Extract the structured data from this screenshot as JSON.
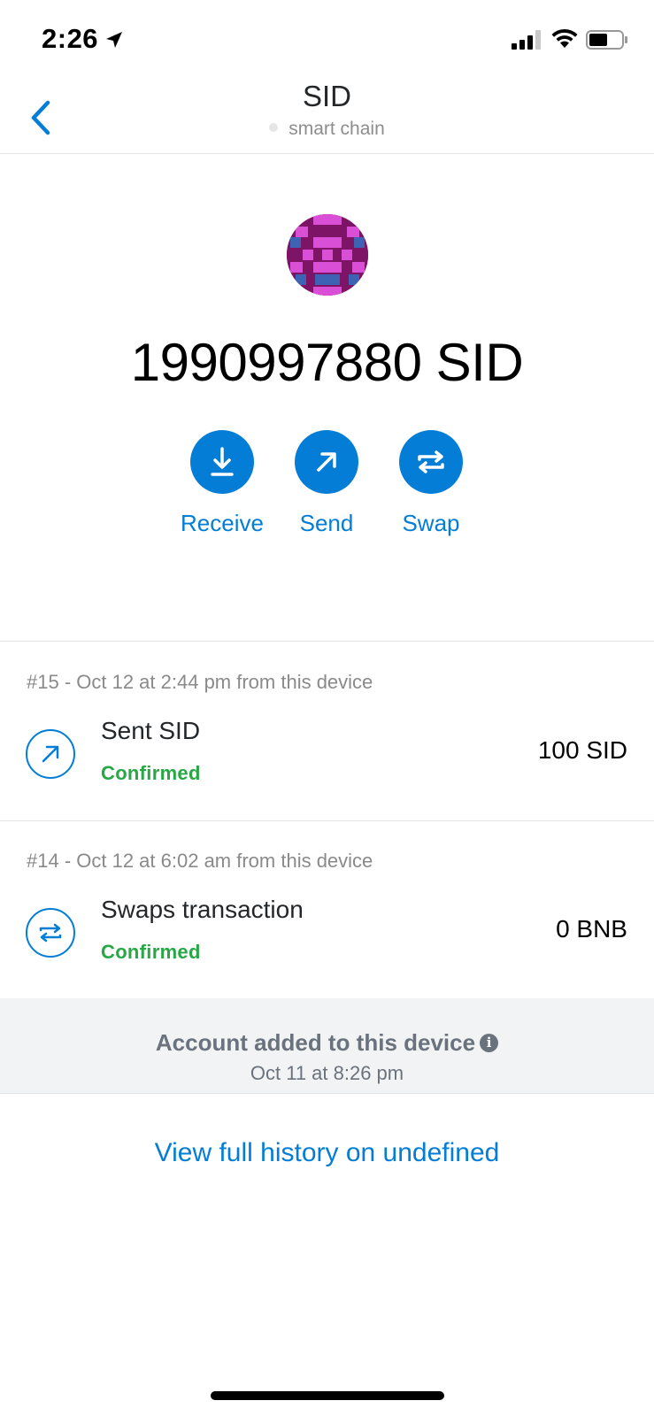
{
  "status_bar": {
    "time": "2:26"
  },
  "header": {
    "title": "SID",
    "network": "smart chain"
  },
  "token": {
    "balance": "1990997880 SID"
  },
  "actions": [
    {
      "label": "Receive",
      "icon": "receive-icon"
    },
    {
      "label": "Send",
      "icon": "send-arrow-icon"
    },
    {
      "label": "Swap",
      "icon": "swap-icon"
    }
  ],
  "transactions": [
    {
      "meta": "#15 - Oct 12 at 2:44 pm from this device",
      "title": "Sent SID",
      "status": "Confirmed",
      "amount": "100 SID",
      "icon": "send-arrow-icon"
    },
    {
      "meta": "#14 - Oct 12 at 6:02 am from this device",
      "title": "Swaps transaction",
      "status": "Confirmed",
      "amount": "0 BNB",
      "icon": "swap-icon"
    }
  ],
  "account_banner": {
    "title": "Account added to this device",
    "date": "Oct 11 at 8:26 pm"
  },
  "history_link": "View full history on undefined",
  "colors": {
    "accent": "#037dd6",
    "confirmed": "#28a745",
    "avatar_base": "#7d1466",
    "avatar_pink": "#d94fd6",
    "avatar_blue": "#3e63b5"
  }
}
